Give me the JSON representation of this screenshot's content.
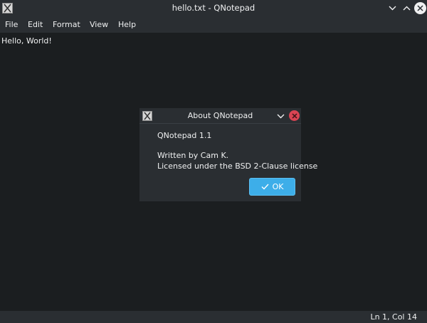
{
  "window": {
    "title": "hello.txt - QNotepad"
  },
  "menubar": {
    "items": [
      "File",
      "Edit",
      "Format",
      "View",
      "Help"
    ]
  },
  "editor": {
    "content": "Hello, World!"
  },
  "statusbar": {
    "position": "Ln 1, Col 14"
  },
  "dialog": {
    "title": "About QNotepad",
    "version": "QNotepad 1.1",
    "author": "Written by Cam K.",
    "license": "Licensed under the BSD 2-Clause license",
    "ok_label": "OK"
  },
  "icons": {
    "app": "app-icon",
    "minimize": "chevron-down-icon",
    "maximize": "chevron-up-icon",
    "close": "close-icon",
    "ok": "check-icon"
  },
  "colors": {
    "background": "#1b1e20",
    "chrome": "#2a2e32",
    "accent": "#3daee9",
    "close_red": "#da4453",
    "text": "#eff0f1"
  }
}
